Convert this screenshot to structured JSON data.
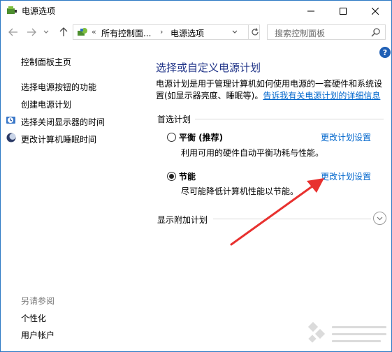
{
  "window": {
    "title": "电源选项"
  },
  "nav": {
    "breadcrumb_prefix": "«",
    "breadcrumb": [
      "所有控制面...",
      "电源选项"
    ],
    "breadcrumb_sep": "›",
    "search_placeholder": "搜索控制面板"
  },
  "help": "?",
  "sidebar": {
    "items": [
      {
        "label": "控制面板主页"
      },
      {
        "label": "选择电源按钮的功能"
      },
      {
        "label": "创建电源计划"
      },
      {
        "label": "选择关闭显示器的时间"
      },
      {
        "label": "更改计算机睡眠时间"
      }
    ],
    "see_also_title": "另请参阅",
    "see_also": [
      {
        "label": "个性化"
      },
      {
        "label": "用户帐户"
      }
    ]
  },
  "main": {
    "title": "选择或自定义电源计划",
    "desc_line1": "电源计划是用于管理计算机如何使用电源的一套硬件和系统设",
    "desc_line2": "置(如显示器亮度、睡眠等)。",
    "desc_link": "告诉我有关电源计划的详细信息",
    "preferred_label": "首选计划",
    "plans": [
      {
        "name": "平衡 (推荐)",
        "desc": "利用可用的硬件自动平衡功耗与性能。",
        "link": "更改计划设置",
        "selected": false
      },
      {
        "name": "节能",
        "desc": "尽可能降低计算机性能以节能。",
        "link": "更改计划设置",
        "selected": true
      }
    ],
    "extra_label": "显示附加计划"
  },
  "colors": {
    "accent_title": "#1e3287",
    "link": "#0066cc",
    "arrow": "#e8312f"
  }
}
